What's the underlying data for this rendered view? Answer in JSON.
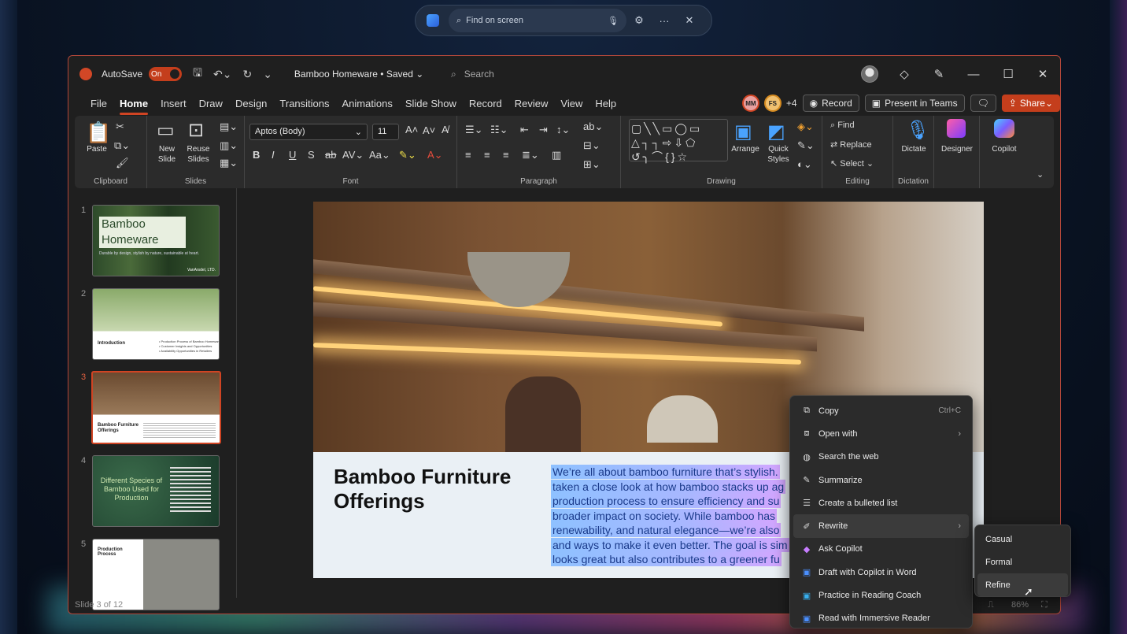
{
  "findbar": {
    "placeholder": "Find on screen"
  },
  "titlebar": {
    "autosave_label": "AutoSave",
    "toggle_state": "On",
    "doc_title": "Bamboo Homeware • Saved ⌄",
    "search_placeholder": "Search"
  },
  "menu": {
    "items": [
      "File",
      "Home",
      "Insert",
      "Draw",
      "Design",
      "Transitions",
      "Animations",
      "Slide Show",
      "Record",
      "Review",
      "View",
      "Help"
    ],
    "active": "Home"
  },
  "collab": {
    "p1": "MM",
    "p2": "FS",
    "more": "+4",
    "record": "Record",
    "present": "Present in Teams",
    "share": "Share"
  },
  "ribbon": {
    "clipboard": {
      "paste": "Paste",
      "label": "Clipboard"
    },
    "slides": {
      "new": "New\nSlide",
      "reuse": "Reuse\nSlides",
      "label": "Slides"
    },
    "font": {
      "name": "Aptos (Body)",
      "size": "11",
      "label": "Font"
    },
    "paragraph": {
      "label": "Paragraph"
    },
    "drawing": {
      "arrange": "Arrange",
      "quick": "Quick\nStyles",
      "label": "Drawing"
    },
    "editing": {
      "find": "Find",
      "replace": "Replace",
      "select": "Select",
      "label": "Editing"
    },
    "dictation": {
      "dictate": "Dictate",
      "label": "Dictation"
    },
    "designer": "Designer",
    "copilot": "Copilot"
  },
  "thumbs": {
    "n1": "1",
    "n2": "2",
    "n3": "3",
    "n4": "4",
    "n5": "5",
    "t1_title": "Bamboo Homeware",
    "t1_sub": "Durable by design, stylish by nature, sustainable at heart.",
    "t1_brand": "VanArsdel, LTD.",
    "t2_title": "Introduction",
    "t2_bullets": "• Production Process of Bamboo Homeware\n• Customer Insights and Opportunities\n• Availability Opportunities in Retailers",
    "t3_title": "Bamboo Furniture Offerings",
    "t4_title": "Different Species of Bamboo Used for Production",
    "t5_title": "Production Process"
  },
  "slide": {
    "title": "Bamboo Furniture Offerings",
    "line1": "We’re all about bamboo furniture that’s stylish.",
    "line2": "taken a close look at how bamboo stacks up ag",
    "line3": "production process to ensure efficiency and su",
    "line4": "broader impact on society. While bamboo has",
    "line5": "renewability, and natural elegance—we’re also",
    "line6": "and ways to make it even better. The goal is sim",
    "line7": "looks great but also contributes to a greener fu"
  },
  "status": {
    "slide": "Slide 3 of 12",
    "zoom": "86%"
  },
  "context_menu": {
    "copy": "Copy",
    "copy_sc": "Ctrl+C",
    "open_with": "Open with",
    "search_web": "Search the web",
    "summarize": "Summarize",
    "bulleted": "Create a bulleted list",
    "rewrite": "Rewrite",
    "ask_copilot": "Ask Copilot",
    "draft": "Draft with Copilot in Word",
    "practice": "Practice in Reading Coach",
    "immersive": "Read with Immersive Reader"
  },
  "submenu": {
    "casual": "Casual",
    "formal": "Formal",
    "refine": "Refine"
  }
}
